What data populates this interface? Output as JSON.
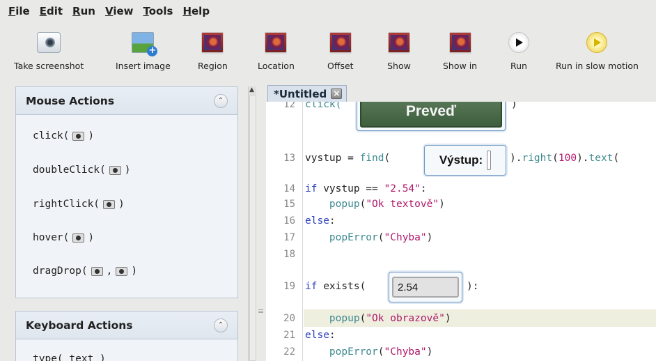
{
  "menu": [
    {
      "label": "File",
      "mnemonic": "F",
      "rest": "ile"
    },
    {
      "label": "Edit",
      "mnemonic": "E",
      "rest": "dit"
    },
    {
      "label": "Run",
      "mnemonic": "R",
      "rest": "un"
    },
    {
      "label": "View",
      "mnemonic": "V",
      "rest": "iew"
    },
    {
      "label": "Tools",
      "mnemonic": "T",
      "rest": "ools"
    },
    {
      "label": "Help",
      "mnemonic": "H",
      "rest": "elp"
    }
  ],
  "toolbar": [
    {
      "label": "Take screenshot",
      "icon": "camera-icon"
    },
    {
      "label": "Insert image",
      "icon": "insert-image-icon"
    },
    {
      "label": "Region",
      "icon": "region-icon"
    },
    {
      "label": "Location",
      "icon": "location-icon"
    },
    {
      "label": "Offset",
      "icon": "offset-icon"
    },
    {
      "label": "Show",
      "icon": "show-icon"
    },
    {
      "label": "Show in",
      "icon": "show-in-icon"
    },
    {
      "label": "Run",
      "icon": "run-icon"
    },
    {
      "label": "Run in slow motion",
      "icon": "run-slow-icon"
    }
  ],
  "sidebar": {
    "mouse_title": "Mouse Actions",
    "mouse_actions": [
      {
        "name": "click(",
        "suffix": ")"
      },
      {
        "name": "doubleClick(",
        "suffix": ")"
      },
      {
        "name": "rightClick(",
        "suffix": ")"
      },
      {
        "name": "hover(",
        "suffix": ")"
      },
      {
        "name": "dragDrop(",
        "mid": ",",
        "suffix": ")"
      }
    ],
    "keyboard_title": "Keyboard Actions",
    "keyboard_partial": "type( text )"
  },
  "editor": {
    "tab_title": "*Untitled",
    "patterns": {
      "button_text": "Preveď",
      "label_text": "Výstup:",
      "field_value": "2.54"
    },
    "lines": [
      {
        "n": "12",
        "text": "click("
      },
      {
        "n": "13",
        "text": "vystup = find("
      },
      {
        "n": "14",
        "text": "if vystup == \"2.54\":"
      },
      {
        "n": "15",
        "text": "    popup(\"Ok textově\")"
      },
      {
        "n": "16",
        "text": "else:"
      },
      {
        "n": "17",
        "text": "    popError(\"Chyba\")"
      },
      {
        "n": "18",
        "text": ""
      },
      {
        "n": "19",
        "text": "if exists("
      },
      {
        "n": "20",
        "text": "    popup(\"Ok obrazově\")"
      },
      {
        "n": "21",
        "text": "else:"
      },
      {
        "n": "22",
        "text": "    popError(\"Chyba\")"
      }
    ],
    "line13_tail": ").right(100).text(",
    "line19_tail": "):"
  },
  "colors": {
    "keyword": "#2b3fbf",
    "function": "#3d8a8f",
    "string": "#b0166a",
    "current_line": "#efefdf"
  }
}
